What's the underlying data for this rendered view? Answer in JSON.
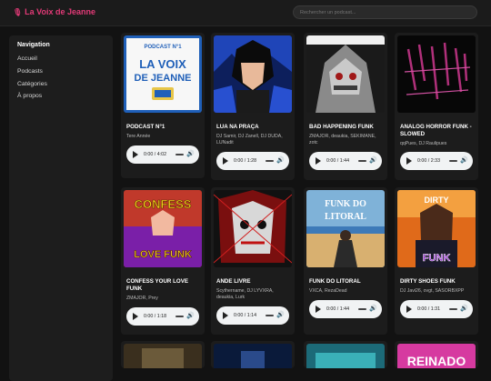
{
  "header": {
    "logo_text": "La Voix de Jeanne",
    "search_placeholder": "Rechercher un podcast..."
  },
  "nav": {
    "heading": "Navigation",
    "items": [
      "Accueil",
      "Podcasts",
      "Catégories",
      "À propos"
    ]
  },
  "podcasts": [
    {
      "title": "PODCAST N°1",
      "artists": "Tere Année",
      "time": "0:00 / 4:02"
    },
    {
      "title": "LUA NA PRAÇA",
      "artists": "DJ Samir, DJ Zanell, DJ DUDA, LUNadit",
      "time": "0:00 / 1:28"
    },
    {
      "title": "BAD HAPPENING FUNK",
      "artists": "ZMAJOR, deaukia, SEKIMANE, zotc",
      "time": "0:00 / 1:44"
    },
    {
      "title": "ANALOG HORROR FUNK - SLOWED",
      "artists": "qqPues, DJ Raulipues",
      "time": "0:00 / 2:33"
    },
    {
      "title": "CONFESS YOUR LOVE FUNK",
      "artists": "ZMAJOR, Prey",
      "time": "0:00 / 1:18"
    },
    {
      "title": "ANDE LIVRE",
      "artists": "Scythername, DJ LYVXRA, deaukia, Lurk",
      "time": "0:00 / 1:14"
    },
    {
      "title": "FUNK DO LITORAL",
      "artists": "VXCA, RezaDead",
      "time": "0:00 / 1:44"
    },
    {
      "title": "DIRTY SHOES FUNK",
      "artists": "DJ Javi26, ovgt, SASORBXPP",
      "time": "0:00 / 1:31"
    }
  ],
  "covers": {
    "podcast1": {
      "line1": "PODCAST N°1",
      "line2": "LA VOIX",
      "line3": "DE JEANNE"
    },
    "confess": {
      "line1": "CONFESS",
      "line2": "LOVE FUNK"
    },
    "litoral": {
      "line1": "FUNK DO",
      "line2": "LITORAL"
    },
    "dirty": {
      "line1": "DIRTY",
      "line2": "FUNK"
    },
    "reinado": {
      "line1": "REINADO"
    }
  },
  "colors": {
    "accent": "#e23a77",
    "background": "#121212",
    "card": "#1c1c1c"
  }
}
